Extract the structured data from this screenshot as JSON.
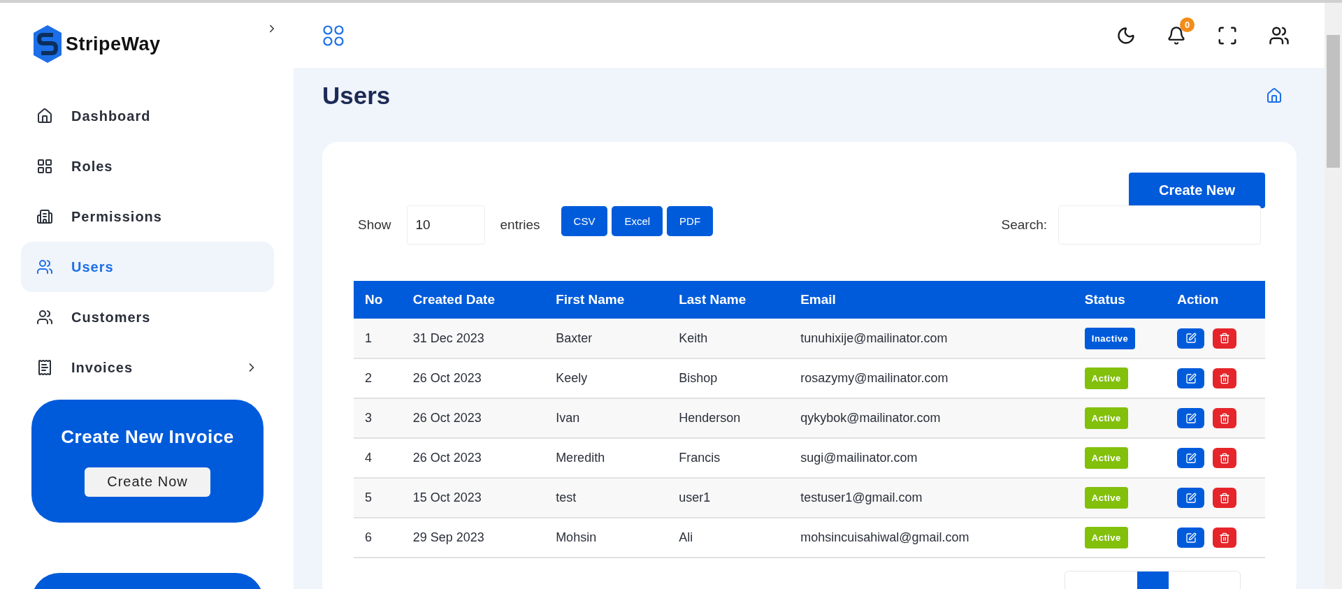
{
  "brand": {
    "name": "StripeWay"
  },
  "sidebar": {
    "items": [
      {
        "label": "Dashboard",
        "selected": false,
        "has_submenu": false
      },
      {
        "label": "Roles",
        "selected": false,
        "has_submenu": false
      },
      {
        "label": "Permissions",
        "selected": false,
        "has_submenu": false
      },
      {
        "label": "Users",
        "selected": true,
        "has_submenu": false
      },
      {
        "label": "Customers",
        "selected": false,
        "has_submenu": false
      },
      {
        "label": "Invoices",
        "selected": false,
        "has_submenu": true
      }
    ],
    "promo": {
      "title": "Create New Invoice",
      "button": "Create Now"
    }
  },
  "header": {
    "notifications": "0"
  },
  "page": {
    "title": "Users"
  },
  "card": {
    "create_button": "Create New",
    "show_label": "Show",
    "entries_value": "10",
    "entries_label": "entries",
    "export_buttons": [
      "CSV",
      "Excel",
      "PDF"
    ],
    "search_label": "Search:"
  },
  "table": {
    "columns": [
      "No",
      "Created Date",
      "First Name",
      "Last Name",
      "Email",
      "Status",
      "Action"
    ],
    "rows": [
      {
        "no": "1",
        "created": "31 Dec 2023",
        "first": "Baxter",
        "last": "Keith",
        "email": "tunuhixije@mailinator.com",
        "status": "Inactive",
        "active": false
      },
      {
        "no": "2",
        "created": "26 Oct 2023",
        "first": "Keely",
        "last": "Bishop",
        "email": "rosazymy@mailinator.com",
        "status": "Active",
        "active": true
      },
      {
        "no": "3",
        "created": "26 Oct 2023",
        "first": "Ivan",
        "last": "Henderson",
        "email": "qykybok@mailinator.com",
        "status": "Active",
        "active": true
      },
      {
        "no": "4",
        "created": "26 Oct 2023",
        "first": "Meredith",
        "last": "Francis",
        "email": "sugi@mailinator.com",
        "status": "Active",
        "active": true
      },
      {
        "no": "5",
        "created": "15 Oct 2023",
        "first": "test",
        "last": "user1",
        "email": "testuser1@gmail.com",
        "status": "Active",
        "active": true
      },
      {
        "no": "6",
        "created": "29 Sep 2023",
        "first": "Mohsin",
        "last": "Ali",
        "email": "mohsincuisahiwal@gmail.com",
        "status": "Active",
        "active": true
      }
    ]
  }
}
